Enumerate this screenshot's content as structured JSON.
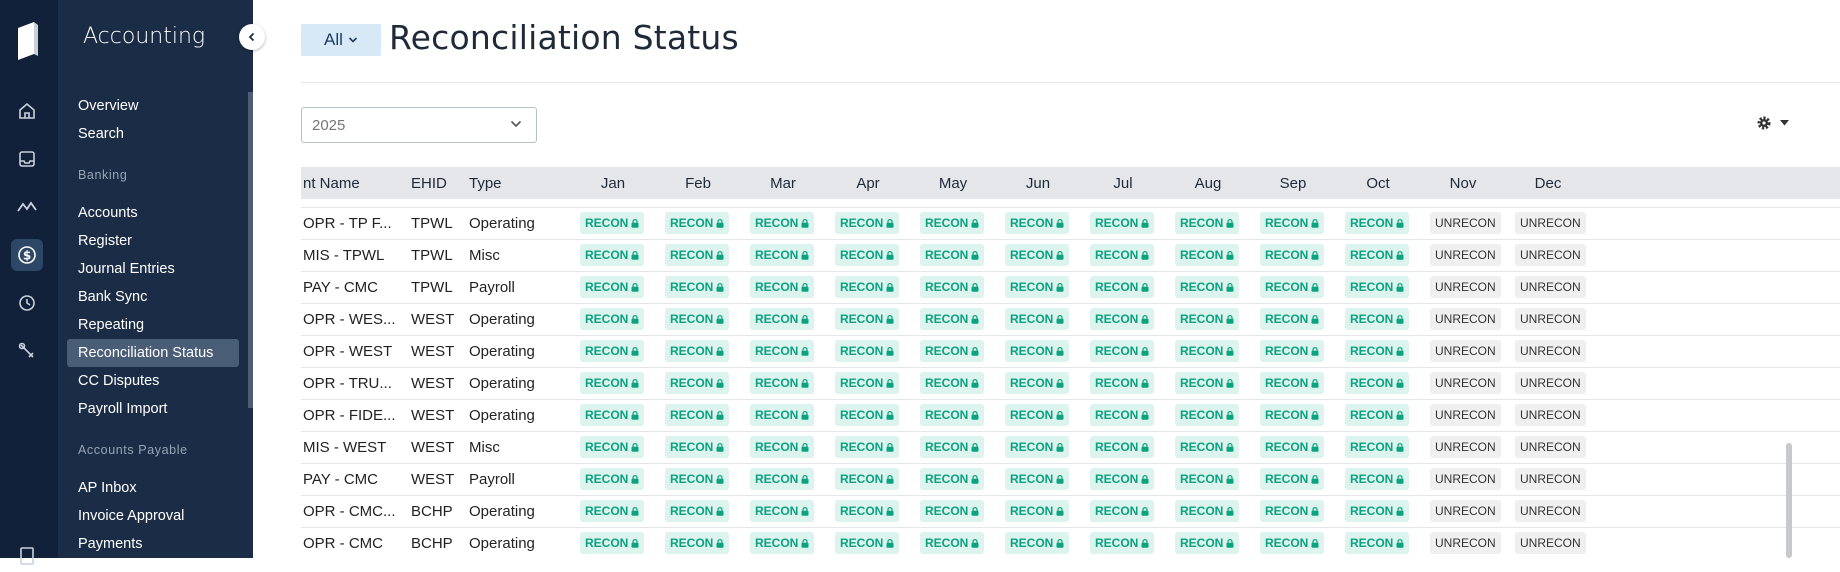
{
  "app": {
    "section_title": "Accounting"
  },
  "rail_icons": [
    "home-icon",
    "inbox-icon",
    "analytics-icon",
    "dollar-icon",
    "clock-icon",
    "tools-icon"
  ],
  "sidebar": {
    "nav_top": [
      "Overview",
      "Search"
    ],
    "banking_header": "Banking",
    "banking": [
      "Accounts",
      "Register",
      "Journal Entries",
      "Bank Sync",
      "Repeating",
      "Reconciliation Status",
      "CC Disputes",
      "Payroll Import"
    ],
    "ap_header": "Accounts Payable",
    "ap": [
      "AP Inbox",
      "Invoice Approval",
      "Payments"
    ],
    "active": "Reconciliation Status"
  },
  "header": {
    "filter_label": "All",
    "title": "Reconciliation Status"
  },
  "year_select": {
    "value": "2025"
  },
  "table": {
    "columns": [
      "nt Name",
      "EHID",
      "Type",
      "Jan",
      "Feb",
      "Mar",
      "Apr",
      "May",
      "Jun",
      "Jul",
      "Aug",
      "Sep",
      "Oct",
      "Nov",
      "Dec"
    ],
    "rows": [
      {
        "name": "OPR - TP F...",
        "ehid": "TPWL",
        "type": "Operating"
      },
      {
        "name": "MIS - TPWL",
        "ehid": "TPWL",
        "type": "Misc"
      },
      {
        "name": "PAY - CMC",
        "ehid": "TPWL",
        "type": "Payroll"
      },
      {
        "name": "OPR - WES...",
        "ehid": "WEST",
        "type": "Operating"
      },
      {
        "name": "OPR - WEST",
        "ehid": "WEST",
        "type": "Operating"
      },
      {
        "name": "OPR - TRU...",
        "ehid": "WEST",
        "type": "Operating"
      },
      {
        "name": "OPR - FIDE...",
        "ehid": "WEST",
        "type": "Operating"
      },
      {
        "name": "MIS - WEST",
        "ehid": "WEST",
        "type": "Misc"
      },
      {
        "name": "PAY - CMC",
        "ehid": "WEST",
        "type": "Payroll"
      },
      {
        "name": "OPR - CMC...",
        "ehid": "BCHP",
        "type": "Operating"
      },
      {
        "name": "OPR - CMC",
        "ehid": "BCHP",
        "type": "Operating"
      }
    ],
    "month_status": [
      "RECON",
      "RECON",
      "RECON",
      "RECON",
      "RECON",
      "RECON",
      "RECON",
      "RECON",
      "RECON",
      "RECON",
      "UNRECON",
      "UNRECON"
    ],
    "recon_label": "RECON",
    "unrecon_label": "UNRECON"
  },
  "colors": {
    "rail": "#11213a",
    "panel": "#1b2d46",
    "recon_bg": "#dcf3ee",
    "recon_text": "#0aa27f"
  }
}
